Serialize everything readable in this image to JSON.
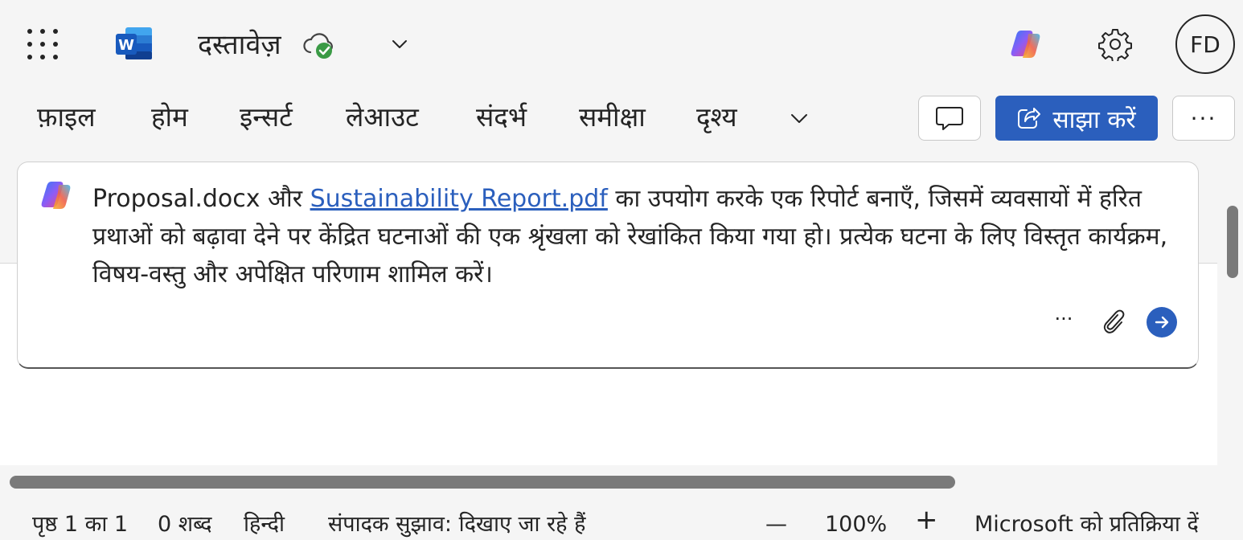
{
  "titlebar": {
    "app_icon": "word-logo-icon",
    "app_letter": "W",
    "document_title": "दस्तावेज़",
    "cloud_status_icon": "cloud-saved-icon",
    "title_menu_icon": "chevron-down-icon",
    "copilot_icon": "copilot-icon",
    "settings_icon": "gear-icon",
    "avatar_initials": "FD"
  },
  "ribbon": {
    "tabs": [
      {
        "label": "फ़ाइल"
      },
      {
        "label": "होम"
      },
      {
        "label": "इन्सर्ट"
      },
      {
        "label": "लेआउट"
      },
      {
        "label": "संदर्भ"
      },
      {
        "label": "समीक्षा"
      },
      {
        "label": "दृश्य"
      }
    ],
    "more_tabs_icon": "chevron-down-icon",
    "comment_icon": "comment-icon",
    "share_label": "साझा करें",
    "share_icon": "share-icon",
    "more_options": "···"
  },
  "prompt": {
    "copilot_icon": "copilot-icon",
    "text_before_link": "Proposal.docx और ",
    "link_text": "Sustainability Report.pdf",
    "text_after_link": " का उपयोग करके एक रिपोर्ट बनाएँ, जिसमें व्यवसायों में हरित प्रथाओं को बढ़ावा देने पर केंद्रित घटनाओं की एक श्रृंखला को रेखांकित किया गया हो। प्रत्येक घटना के लिए विस्तृत कार्यक्रम, विषय-वस्तु और अपेक्षित परिणाम शामिल करें।",
    "more_label": "···",
    "attach_icon": "paperclip-icon",
    "send_icon": "arrow-right-icon"
  },
  "statusbar": {
    "page": "पृष्ठ 1 का 1",
    "words": "0 शब्द",
    "language": "हिन्दी",
    "editor": "संपादक सुझाव: दिखाए जा रहे हैं",
    "zoom_out": "—",
    "zoom": "100%",
    "zoom_in": "+",
    "feedback": "Microsoft को प्रतिक्रिया दें"
  },
  "colors": {
    "accent": "#2b5fbd",
    "word_blue": "#185abd",
    "check_green": "#3a9a45",
    "background": "#f5f5f5"
  }
}
